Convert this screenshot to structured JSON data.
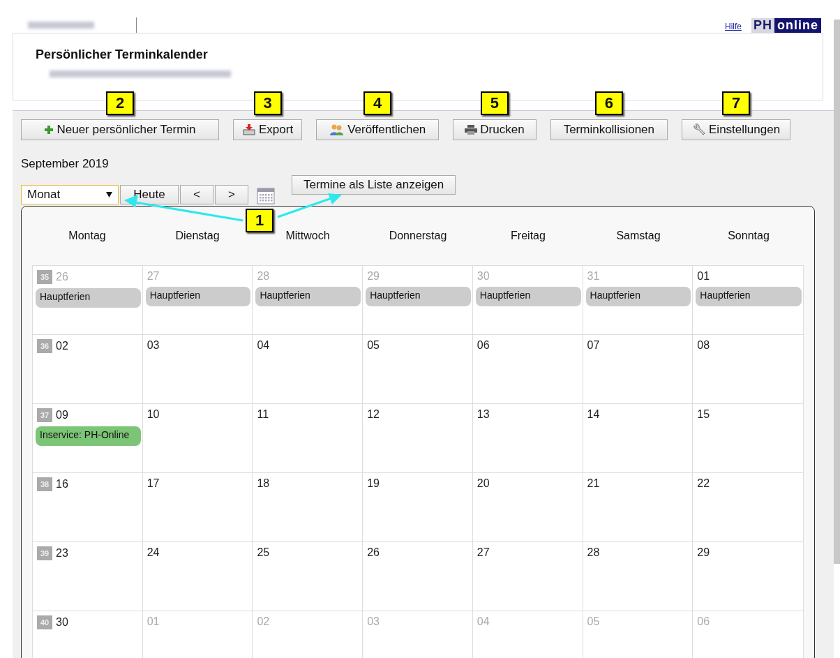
{
  "header": {
    "help_link": "Hilfe",
    "logo": [
      "PH",
      "online"
    ],
    "title": "Persönlicher Terminkalender"
  },
  "toolbar": [
    {
      "label": "Neuer persönlicher Termin",
      "kind": "plus",
      "callout": "2"
    },
    {
      "label": "Export",
      "kind": "export",
      "callout": "3"
    },
    {
      "label": "Veröffentlichen",
      "kind": "people",
      "callout": "4"
    },
    {
      "label": "Drucken",
      "kind": "printer",
      "callout": "5"
    },
    {
      "label": "Terminkollisionen",
      "kind": "text",
      "callout": "6"
    },
    {
      "label": "Einstellungen",
      "kind": "wrench",
      "callout": "7"
    }
  ],
  "month_label": "September 2019",
  "view_select": "Monat",
  "nav_buttons": [
    "Heute",
    "<",
    ">"
  ],
  "list_button": "Termine als Liste anzeigen",
  "callout_1": "1",
  "weekdays": [
    "Montag",
    "Dienstag",
    "Mittwoch",
    "Donnerstag",
    "Freitag",
    "Samstag",
    "Sonntag"
  ],
  "weeks": [
    {
      "week": "35",
      "days": [
        {
          "day": "26",
          "other_month": true,
          "events": [
            {
              "title": "Hauptferien",
              "color": "#cccccc"
            }
          ]
        },
        {
          "day": "27",
          "other_month": true,
          "events": [
            {
              "title": "Hauptferien",
              "color": "#cccccc"
            }
          ]
        },
        {
          "day": "28",
          "other_month": true,
          "events": [
            {
              "title": "Hauptferien",
              "color": "#cccccc"
            }
          ]
        },
        {
          "day": "29",
          "other_month": true,
          "events": [
            {
              "title": "Hauptferien",
              "color": "#cccccc"
            }
          ]
        },
        {
          "day": "30",
          "other_month": true,
          "events": [
            {
              "title": "Hauptferien",
              "color": "#cccccc"
            }
          ]
        },
        {
          "day": "31",
          "other_month": true,
          "events": [
            {
              "title": "Hauptferien",
              "color": "#cccccc"
            }
          ]
        },
        {
          "day": "01",
          "other_month": false,
          "events": [
            {
              "title": "Hauptferien",
              "color": "#cccccc"
            }
          ]
        }
      ]
    },
    {
      "week": "36",
      "days": [
        {
          "day": "02",
          "other_month": false
        },
        {
          "day": "03",
          "other_month": false
        },
        {
          "day": "04",
          "other_month": false
        },
        {
          "day": "05",
          "other_month": false
        },
        {
          "day": "06",
          "other_month": false
        },
        {
          "day": "07",
          "other_month": false
        },
        {
          "day": "08",
          "other_month": false
        }
      ]
    },
    {
      "week": "37",
      "days": [
        {
          "day": "09",
          "other_month": false,
          "events": [
            {
              "title": "Inservice: PH-Online",
              "color": "#7cc576"
            }
          ]
        },
        {
          "day": "10",
          "other_month": false
        },
        {
          "day": "11",
          "other_month": false
        },
        {
          "day": "12",
          "other_month": false
        },
        {
          "day": "13",
          "other_month": false
        },
        {
          "day": "14",
          "other_month": false
        },
        {
          "day": "15",
          "other_month": false
        }
      ]
    },
    {
      "week": "38",
      "days": [
        {
          "day": "16",
          "other_month": false
        },
        {
          "day": "17",
          "other_month": false
        },
        {
          "day": "18",
          "other_month": false
        },
        {
          "day": "19",
          "other_month": false
        },
        {
          "day": "20",
          "other_month": false
        },
        {
          "day": "21",
          "other_month": false
        },
        {
          "day": "22",
          "other_month": false
        }
      ]
    },
    {
      "week": "39",
      "days": [
        {
          "day": "23",
          "other_month": false
        },
        {
          "day": "24",
          "other_month": false
        },
        {
          "day": "25",
          "other_month": false
        },
        {
          "day": "26",
          "other_month": false
        },
        {
          "day": "27",
          "other_month": false
        },
        {
          "day": "28",
          "other_month": false
        },
        {
          "day": "29",
          "other_month": false
        }
      ]
    },
    {
      "week": "40",
      "days": [
        {
          "day": "30",
          "other_month": false
        },
        {
          "day": "01",
          "other_month": true
        },
        {
          "day": "02",
          "other_month": true
        },
        {
          "day": "03",
          "other_month": true
        },
        {
          "day": "04",
          "other_month": true
        },
        {
          "day": "05",
          "other_month": true
        },
        {
          "day": "06",
          "other_month": true
        }
      ]
    }
  ]
}
